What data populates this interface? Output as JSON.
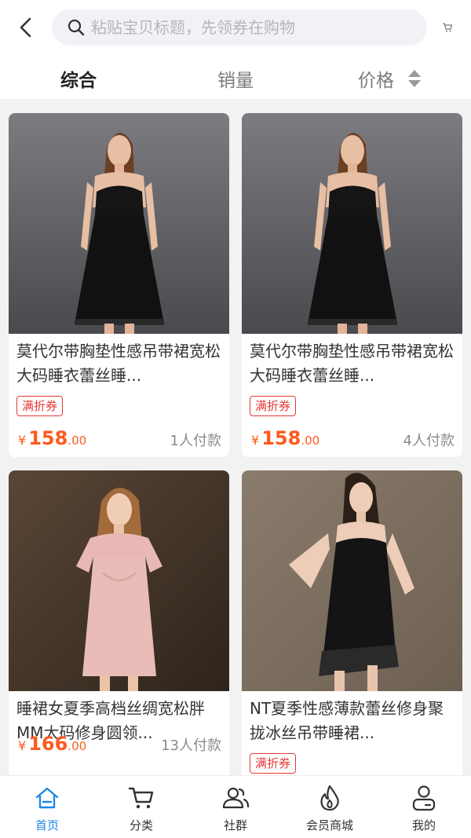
{
  "header": {
    "search_placeholder": "粘贴宝贝标题，先领券在购物"
  },
  "sort": {
    "tabs": [
      {
        "label": "综合",
        "active": true
      },
      {
        "label": "销量",
        "active": false
      },
      {
        "label": "价格",
        "active": false
      }
    ]
  },
  "products": [
    {
      "title": "莫代尔带胸垫性感吊带裙宽松大码睡衣蕾丝睡...",
      "coupon": "满折券",
      "price_symbol": "¥",
      "price_int": "158",
      "price_dec": ".00",
      "sales": "1人付款",
      "image": "model-black-slip-dress"
    },
    {
      "title": "莫代尔带胸垫性感吊带裙宽松大码睡衣蕾丝睡...",
      "coupon": "满折券",
      "price_symbol": "¥",
      "price_int": "158",
      "price_dec": ".00",
      "sales": "4人付款",
      "image": "model-black-slip-dress"
    },
    {
      "title": "睡裙女夏季高档丝绸宽松胖MM大码修身圆领...",
      "coupon": "",
      "price_symbol": "¥",
      "price_int": "166",
      "price_dec": ".00",
      "sales": "13人付款",
      "image": "model-pink-silk-nightgown"
    },
    {
      "title": "NT夏季性感薄款蕾丝修身聚拢冰丝吊带睡裙...",
      "coupon": "满折券",
      "price_symbol": "¥",
      "price_int": "",
      "price_dec": "",
      "sales": "",
      "image": "model-black-lace-slip"
    }
  ],
  "tabbar": {
    "items": [
      {
        "label": "首页",
        "icon": "home-icon",
        "active": true
      },
      {
        "label": "分类",
        "icon": "cart-icon",
        "active": false
      },
      {
        "label": "社群",
        "icon": "community-icon",
        "active": false
      },
      {
        "label": "会员商城",
        "icon": "flame-icon",
        "active": false
      },
      {
        "label": "我的",
        "icon": "user-icon",
        "active": false
      }
    ]
  },
  "colors": {
    "accent": "#1e88e5",
    "price": "#ff5a1f",
    "coupon": "#e53935"
  }
}
